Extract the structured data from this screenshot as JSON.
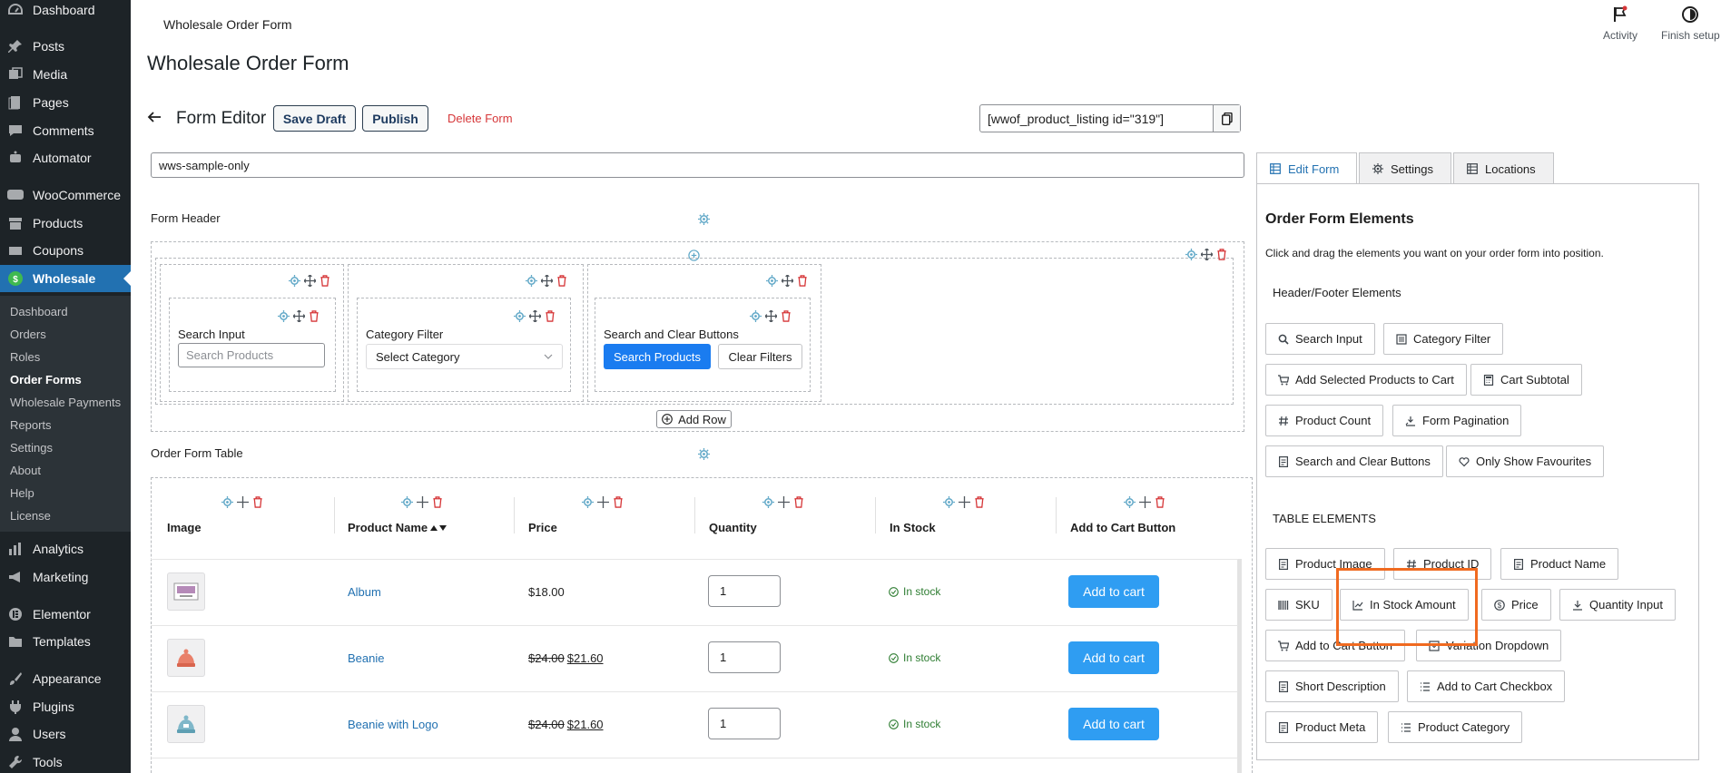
{
  "sidebar": {
    "items": [
      {
        "label": "Dashboard",
        "icon": "dashboard-icon"
      },
      {
        "label": "Posts",
        "icon": "pin-icon"
      },
      {
        "label": "Media",
        "icon": "media-icon"
      },
      {
        "label": "Pages",
        "icon": "page-icon"
      },
      {
        "label": "Comments",
        "icon": "comment-icon"
      },
      {
        "label": "Automator",
        "icon": "automator-icon"
      },
      {
        "label": "WooCommerce",
        "icon": "woo-icon"
      },
      {
        "label": "Products",
        "icon": "archive-icon"
      },
      {
        "label": "Coupons",
        "icon": "coupon-icon"
      },
      {
        "label": "Wholesale",
        "icon": "wholesale-icon"
      },
      {
        "label": "Analytics",
        "icon": "chart-bar-icon"
      },
      {
        "label": "Marketing",
        "icon": "megaphone-icon"
      },
      {
        "label": "Elementor",
        "icon": "elementor-icon"
      },
      {
        "label": "Templates",
        "icon": "folder-icon"
      },
      {
        "label": "Appearance",
        "icon": "brush-icon"
      },
      {
        "label": "Plugins",
        "icon": "plugin-icon"
      },
      {
        "label": "Users",
        "icon": "user-icon"
      },
      {
        "label": "Tools",
        "icon": "wrench-icon"
      }
    ],
    "submenu": [
      "Dashboard",
      "Orders",
      "Roles",
      "Order Forms",
      "Wholesale Payments",
      "Reports",
      "Settings",
      "About",
      "Help",
      "License"
    ]
  },
  "topbar": {
    "title": "Wholesale Order Form",
    "activity": "Activity",
    "finish_setup": "Finish setup"
  },
  "page": {
    "title": "Wholesale Order Form",
    "editor_title": "Form Editor",
    "save_draft": "Save Draft",
    "publish": "Publish",
    "delete_form": "Delete Form",
    "shortcode": "[wwof_product_listing id=\"319\"]",
    "form_name": "wws-sample-only"
  },
  "form_header": {
    "label": "Form Header",
    "search_input_label": "Search Input",
    "search_placeholder": "Search Products",
    "category_label": "Category Filter",
    "category_value": "Select Category",
    "search_clear_label": "Search and Clear Buttons",
    "search_button": "Search Products",
    "clear_button": "Clear Filters",
    "add_row": "Add Row"
  },
  "table": {
    "label": "Order Form Table",
    "columns": [
      "Image",
      "Product Name",
      "Price",
      "Quantity",
      "In Stock",
      "Add to Cart Button"
    ],
    "rows": [
      {
        "name": "Album",
        "price": "$18.00",
        "old_price": "",
        "new_price": "",
        "qty": "1",
        "stock": "In stock",
        "cart": "Add to cart"
      },
      {
        "name": "Beanie",
        "price": "",
        "old_price": "$24.00",
        "new_price": "$21.60",
        "qty": "1",
        "stock": "In stock",
        "cart": "Add to cart"
      },
      {
        "name": "Beanie with Logo",
        "price": "",
        "old_price": "$24.00",
        "new_price": "$21.60",
        "qty": "1",
        "stock": "In stock",
        "cart": "Add to cart"
      }
    ]
  },
  "panel": {
    "tabs": [
      "Edit Form",
      "Settings",
      "Locations"
    ],
    "title": "Order Form Elements",
    "description": "Click and drag the elements you want on your order form into position.",
    "header_footer_label": "Header/Footer Elements",
    "header_footer": [
      "Search Input",
      "Category Filter",
      "Add Selected Products to Cart",
      "Cart Subtotal",
      "Product Count",
      "Form Pagination",
      "Search and Clear Buttons",
      "Only Show Favourites"
    ],
    "table_label": "TABLE ELEMENTS",
    "table_elements": [
      "Product Image",
      "Product ID",
      "Product Name",
      "SKU",
      "In Stock Amount",
      "Price",
      "Quantity Input",
      "Add to Cart Button",
      "Variation Dropdown",
      "Short Description",
      "Add to Cart Checkbox",
      "Product Meta",
      "Product Category"
    ]
  },
  "colors": {
    "sidebar_bg": "#1d2327",
    "accent": "#2271b1",
    "highlight": "#f06a20",
    "cart_button": "#2f9df2",
    "delete": "#d63638"
  }
}
